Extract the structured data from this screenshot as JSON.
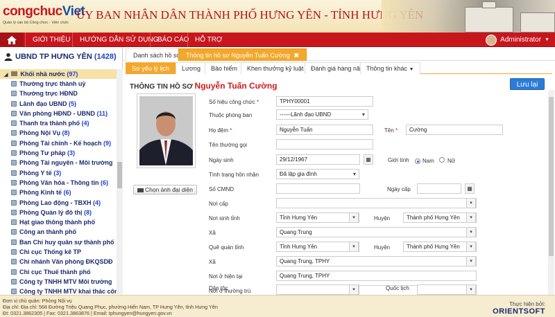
{
  "header": {
    "logo_text_a": "congchuc",
    "logo_text_b": "Viet",
    "logo_tagline": "Quản lý cán bộ Công chức - Viên chức",
    "title": "ỦY BAN NHÂN DÂN THÀNH PHỐ HƯNG YÊN - TỈNH HƯNG YÊN"
  },
  "nav": {
    "items": [
      "GIỚI THIỆU",
      "HƯỚNG DẪN SỬ DỤNG",
      "BÁO CÁO",
      "HỖ TRỢ"
    ],
    "user": "Administrator"
  },
  "sidebar": {
    "title": "UBND TP HƯNG YÊN",
    "title_count": "(1428)",
    "root": "Khối nhà nước",
    "root_count": "(97)",
    "items": [
      {
        "label": "Thường trực thành uỷ",
        "count": ""
      },
      {
        "label": "Thường trực HĐND",
        "count": ""
      },
      {
        "label": "Lãnh đạo UBND",
        "count": "(5)"
      },
      {
        "label": "Văn phòng HĐND - UBND",
        "count": "(11)"
      },
      {
        "label": "Thanh tra thành phố",
        "count": "(4)"
      },
      {
        "label": "Phòng Nội Vụ",
        "count": "(8)"
      },
      {
        "label": "Phòng Tài chính - Kế hoạch",
        "count": "(9)"
      },
      {
        "label": "Phòng Tư pháp",
        "count": "(3)"
      },
      {
        "label": "Phòng Tài nguyên - Môi trường",
        "count": ""
      },
      {
        "label": "Phòng Y tế",
        "count": "(3)"
      },
      {
        "label": "Phòng Văn hóa - Thông tin",
        "count": "(6)"
      },
      {
        "label": "Phòng Kinh tế",
        "count": "(6)"
      },
      {
        "label": "Phòng Lao động - TBXH",
        "count": "(4)"
      },
      {
        "label": "Phòng Quản lý đô thị",
        "count": "(8)"
      },
      {
        "label": "Hạt giao thông thành phố",
        "count": ""
      },
      {
        "label": "Công an thành phố",
        "count": ""
      },
      {
        "label": "Ban Chỉ huy quân sự thành phố",
        "count": ""
      },
      {
        "label": "Chi cục Thống kê TP",
        "count": ""
      },
      {
        "label": "Chi nhánh Văn phòng ĐKQSDĐ",
        "count": ""
      },
      {
        "label": "Chi cục Thuế thành phố",
        "count": ""
      },
      {
        "label": "Công ty TNHH MTV Môi trường",
        "count": ""
      },
      {
        "label": "Công ty TNHH MTV khai thác công",
        "count": ""
      }
    ]
  },
  "tabs": {
    "primary": [
      "Danh sách hồ sơ",
      "Thông tin hồ sơ Nguyễn Tuấn Cường"
    ],
    "secondary": [
      "Sơ yếu lý lịch",
      "Lương",
      "Bảo hiểm",
      "Khen thưởng kỷ luật",
      "Đánh giá hàng năm",
      "Thông tin khác"
    ]
  },
  "profile": {
    "heading": "THÔNG TIN HỒ SƠ",
    "name": "Nguyễn Tuấn Cường",
    "save": "Lưu lại",
    "photo_button": "Chọn ảnh đại diện"
  },
  "form": {
    "so_hieu": {
      "label": "Số hiệu công chức",
      "value": "TPHY00001"
    },
    "phong_ban": {
      "label": "Thuộc phòng ban",
      "value": "------Lãnh đạo UBND"
    },
    "ho_dem": {
      "label": "Họ đệm",
      "value": "Nguyễn Tuấn"
    },
    "ten": {
      "label": "Tên",
      "value": "Cường"
    },
    "ten_thuong_goi": {
      "label": "Tên thường gọi",
      "value": ""
    },
    "ngay_sinh": {
      "label": "Ngày sinh",
      "value": "29/12/1967"
    },
    "gioi_tinh": {
      "label": "Giới tính",
      "nam": "Nam",
      "nu": "Nữ"
    },
    "hon_nhan": {
      "label": "Tình trạng hôn nhân",
      "value": "Đã lập gia đình"
    },
    "cmnd": {
      "label": "Số CMND",
      "value": ""
    },
    "ngay_cap": {
      "label": "Ngày cấp",
      "value": ""
    },
    "noi_cap": {
      "label": "Nơi cấp",
      "value": ""
    },
    "noi_sinh_tinh": {
      "label": "Nơi sinh tỉnh",
      "value": "Tỉnh Hưng Yên"
    },
    "noi_sinh_huyen": {
      "label": "Huyện",
      "value": "Thành phố Hưng Yên"
    },
    "noi_sinh_xa": {
      "label": "Xã",
      "value": "Quang Trung"
    },
    "que_quan_tinh": {
      "label": "Quê quán tỉnh",
      "value": "Tỉnh Hưng Yên"
    },
    "que_quan_huyen": {
      "label": "Huyện",
      "value": "Thành phố Hưng Yên"
    },
    "que_quan_xa": {
      "label": "Xã",
      "value": "Quang Trung, TPHY"
    },
    "noi_o_hien_tai": {
      "label": "Nơi ở hiện tại",
      "value": "Quang Trung, TPHY"
    },
    "noi_o_thuong_tru": {
      "label": "Nơi ở thường trú",
      "value": "Quang Trung, TPHY"
    },
    "dan_toc": {
      "label": "Dân tộc",
      "value": ""
    },
    "quoc_tich": {
      "label": "Quốc tịch",
      "value": ""
    }
  },
  "footer": {
    "line1": "Đơn vị chủ quản: Phòng Nội vụ",
    "line2": "Địa chỉ: Địa chỉ: 568 Đường Triệu Quang Phục, phường Hiến Nam, TP Hưng Yên, tỉnh Hưng Yên",
    "line3": "Đt: 0321.3862305 | Fax: 0321.3863876 | Email: tphungyen@hungyen.gov.vn",
    "performed_by": "Thực hiện bởi:",
    "brand": "ORIENTSOFT"
  },
  "colors": {
    "nav": "#c8161d",
    "tab_active": "#f3a82c",
    "save": "#2b7cd8",
    "required": "#d01b1b"
  }
}
